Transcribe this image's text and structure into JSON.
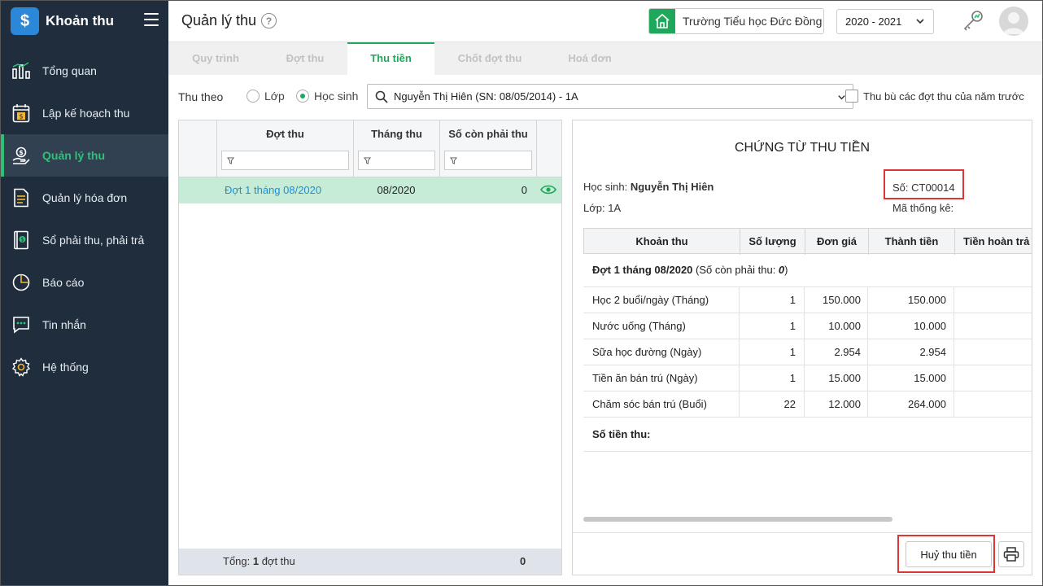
{
  "app": {
    "name": "Khoản thu",
    "logo_glyph": "$"
  },
  "sidebar": {
    "items": [
      {
        "label": "Tổng quan",
        "icon": "bar-chart-icon"
      },
      {
        "label": "Lập kế hoạch thu",
        "icon": "calendar-money-icon"
      },
      {
        "label": "Quản lý thu",
        "icon": "hand-coin-icon",
        "active": true
      },
      {
        "label": "Quản lý hóa đơn",
        "icon": "document-icon"
      },
      {
        "label": "Sổ phải thu, phải trả",
        "icon": "ledger-icon"
      },
      {
        "label": "Báo cáo",
        "icon": "pie-chart-icon"
      },
      {
        "label": "Tin nhắn",
        "icon": "chat-icon"
      },
      {
        "label": "Hệ thống",
        "icon": "gear-icon"
      }
    ]
  },
  "header": {
    "title": "Quản lý thu",
    "help_glyph": "?",
    "school": "Trường Tiểu học Đức Đồng",
    "school_year": "2020 - 2021"
  },
  "tabs": [
    {
      "label": "Quy trình"
    },
    {
      "label": "Đợt thu"
    },
    {
      "label": "Thu tiền",
      "active": true
    },
    {
      "label": "Chốt đợt thu"
    },
    {
      "label": "Hoá đơn"
    }
  ],
  "filter": {
    "thu_theo_label": "Thu theo",
    "option_lop": "Lớp",
    "option_hoc_sinh": "Học sinh",
    "selected_option": "Học sinh",
    "student_value": "Nguyễn Thị Hiên (SN: 08/05/2014) - 1A",
    "carryover_label": "Thu bù các đợt thu của năm trước",
    "carryover_checked": false
  },
  "grid": {
    "columns": [
      "Đợt thu",
      "Tháng thu",
      "Số còn phải thu"
    ],
    "rows": [
      {
        "dot_thu": "Đợt 1 tháng 08/2020",
        "thang_thu": "08/2020",
        "so_con_phai_thu": "0"
      }
    ],
    "footer_prefix": "Tổng: ",
    "footer_count": "1",
    "footer_suffix": " đợt thu",
    "footer_total": "0"
  },
  "voucher": {
    "title": "CHỨNG TỪ THU TIỀN",
    "student_label": "Học sinh: ",
    "student_name": "Nguyễn Thị Hiên",
    "class_label": "Lớp: 1A",
    "number_label": "Số: CT00014",
    "stat_code_label": "Mã thống kê:",
    "columns": [
      "Khoản thu",
      "Số lượng",
      "Đơn giá",
      "Thành tiền",
      "Tiền hoàn trả"
    ],
    "group": {
      "name": "Đợt 1 tháng 08/2020",
      "note_prefix": " (Số còn phải thu: ",
      "note_value": "0",
      "note_suffix": ")"
    },
    "rows": [
      {
        "khoan_thu": "Học 2 buổi/ngày (Tháng)",
        "so_luong": "1",
        "don_gia": "150.000",
        "thanh_tien": "150.000"
      },
      {
        "khoan_thu": "Nước uống (Tháng)",
        "so_luong": "1",
        "don_gia": "10.000",
        "thanh_tien": "10.000"
      },
      {
        "khoan_thu": "Sữa học đường (Ngày)",
        "so_luong": "1",
        "don_gia": "2.954",
        "thanh_tien": "2.954"
      },
      {
        "khoan_thu": "Tiền ăn bán trú (Ngày)",
        "so_luong": "1",
        "don_gia": "15.000",
        "thanh_tien": "15.000"
      },
      {
        "khoan_thu": "Chăm sóc bán trú (Buổi)",
        "so_luong": "22",
        "don_gia": "12.000",
        "thanh_tien": "264.000"
      }
    ],
    "total_label": "Số tiền thu:",
    "cancel_label": "Huỷ thu tiền",
    "print_icon": "printer-icon"
  },
  "colors": {
    "sidebar_bg": "#1f2d3d",
    "accent_green": "#1fa85b",
    "highlight_row": "#c6ecd7",
    "link_blue": "#1a8fd6",
    "annotation_red": "#e03535"
  }
}
